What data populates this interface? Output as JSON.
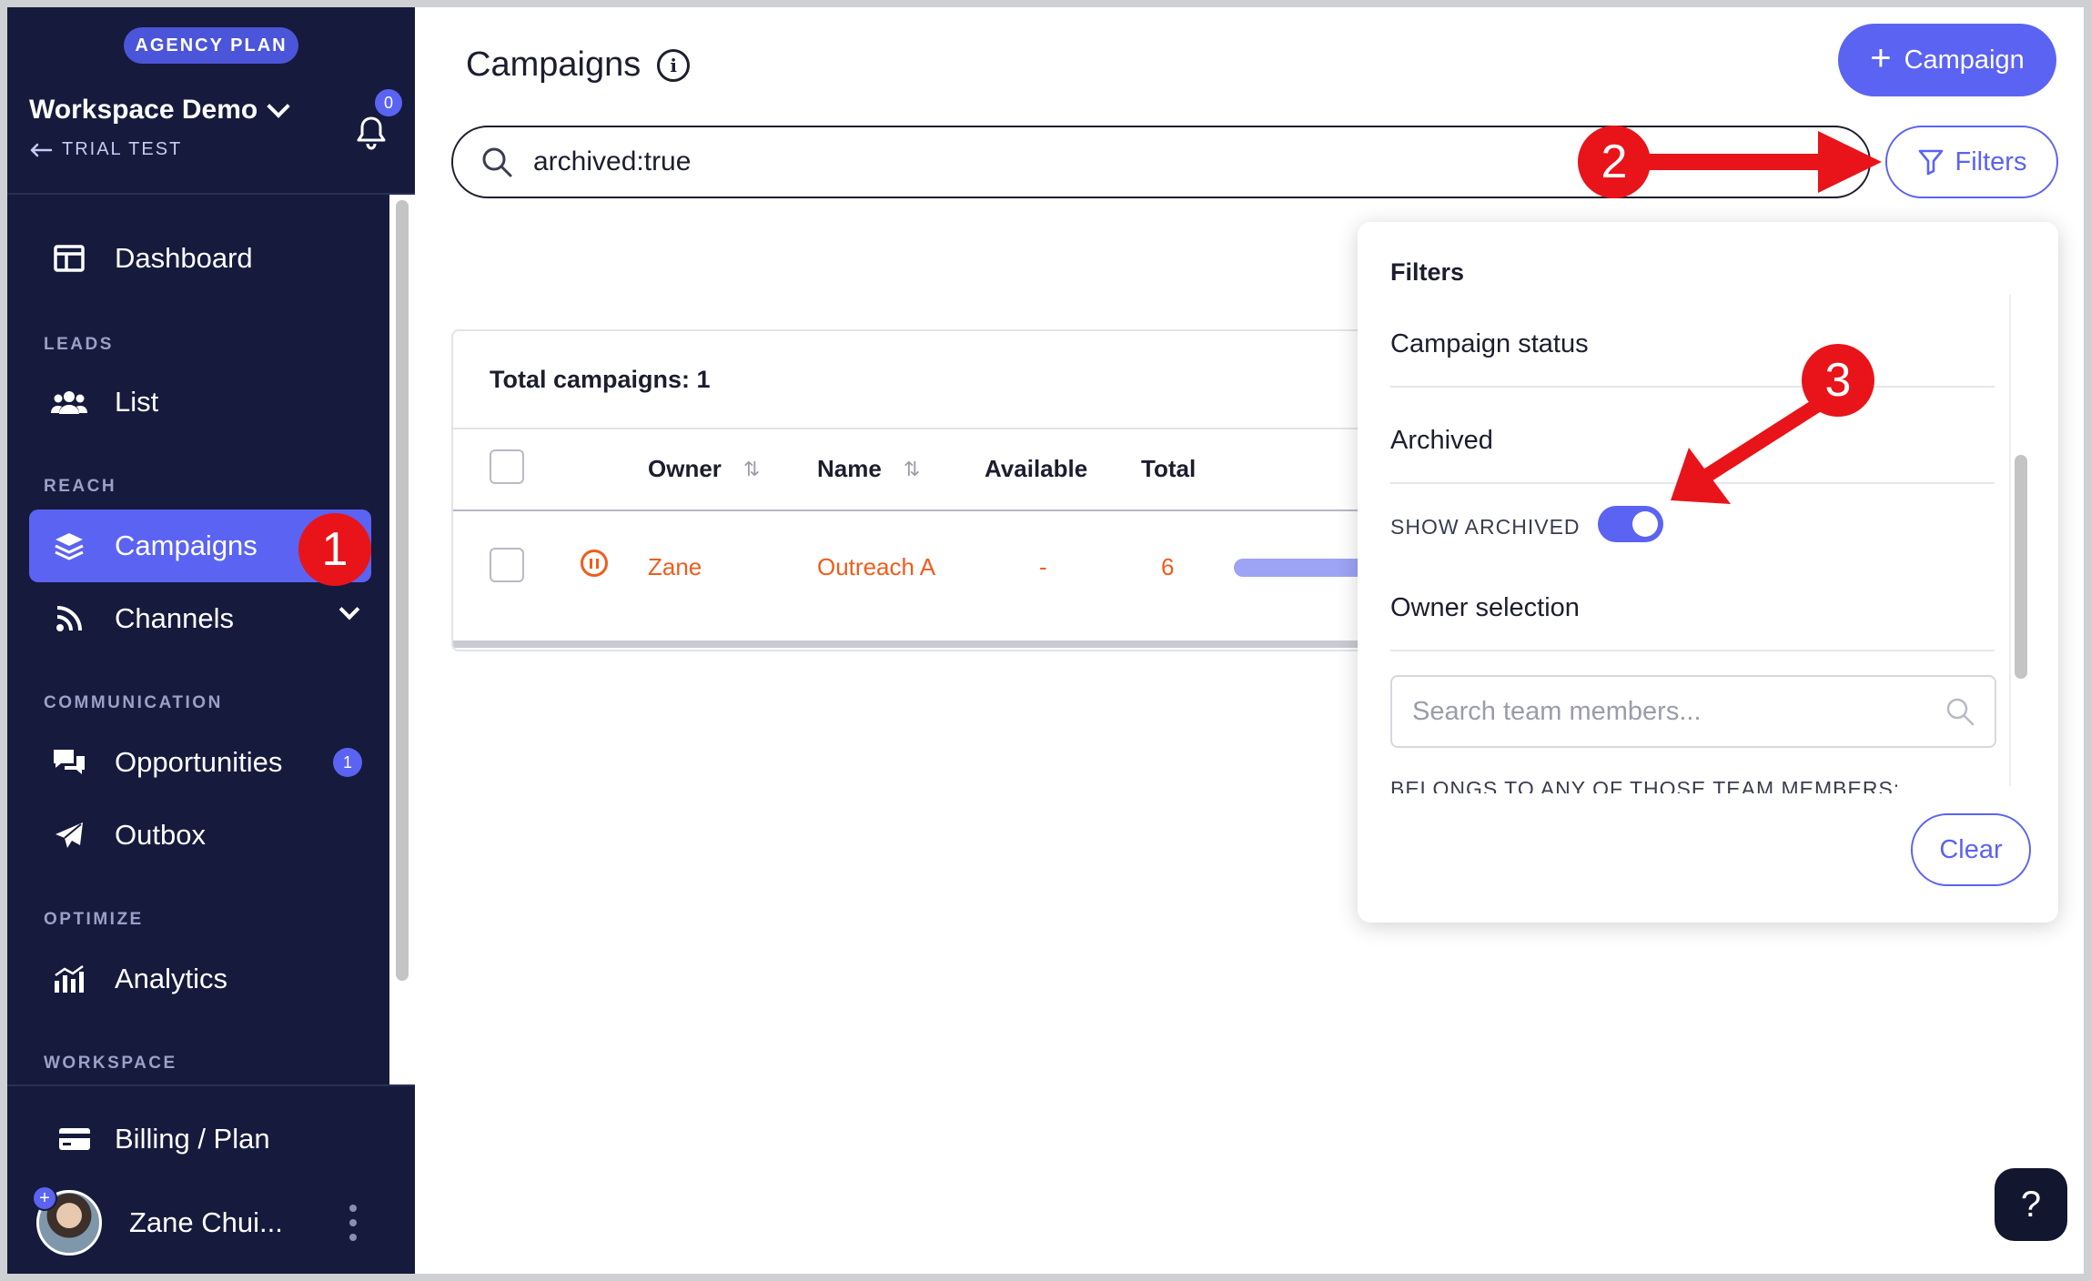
{
  "sidebar": {
    "plan_badge": "AGENCY PLAN",
    "workspace_name": "Workspace Demo",
    "workspace_sub": "TRIAL TEST",
    "notifications_count": "0",
    "dashboard": "Dashboard",
    "sections": {
      "leads": "LEADS",
      "reach": "REACH",
      "communication": "COMMUNICATION",
      "optimize": "OPTIMIZE",
      "workspace": "WORKSPACE"
    },
    "items": {
      "list": "List",
      "campaigns": "Campaigns",
      "channels": "Channels",
      "opportunities": "Opportunities",
      "opportunities_badge": "1",
      "outbox": "Outbox",
      "analytics": "Analytics"
    },
    "billing": "Billing / Plan",
    "user_name": "Zane Chui...",
    "avatar_plus": "+"
  },
  "header": {
    "title": "Campaigns",
    "add_button": "Campaign",
    "add_button_icon": "+"
  },
  "search": {
    "value": "archived:true"
  },
  "filters_button": "Filters",
  "table": {
    "total_label": "Total campaigns: 1",
    "columns": [
      "Owner",
      "Name",
      "Available",
      "Total"
    ],
    "rows": [
      {
        "owner": "Zane",
        "name": "Outreach A",
        "available": "-",
        "total": "6",
        "status_icon": "pause-icon"
      }
    ]
  },
  "filters_panel": {
    "title": "Filters",
    "campaign_status": "Campaign status",
    "archived": "Archived",
    "show_archived": "SHOW ARCHIVED",
    "show_archived_on": true,
    "owner_selection": "Owner selection",
    "search_placeholder": "Search team members...",
    "belongs_label": "BELONGS TO ANY OF THOSE TEAM MEMBERS:",
    "clear": "Clear"
  },
  "help_button": "?",
  "annotations": {
    "step1": "1",
    "step2": "2",
    "step3": "3",
    "color": "#e8141a"
  },
  "colors": {
    "accent": "#5b63f2",
    "sidebar_bg": "#161a3c",
    "status_orange": "#f05c1c"
  }
}
